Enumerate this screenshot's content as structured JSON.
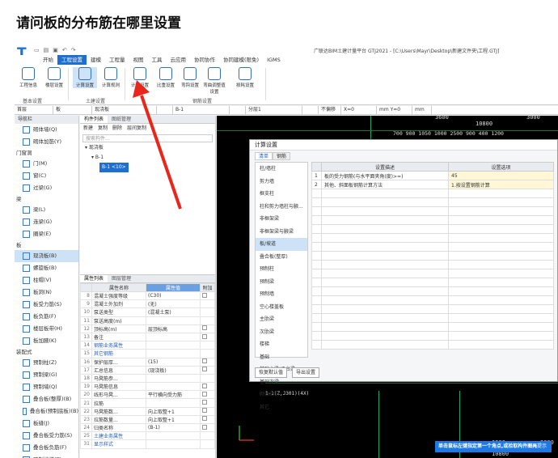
{
  "question": {
    "title": "请问板的分布筋在哪里设置"
  },
  "app": {
    "window_title": "广联达BIM土建计量平台 GTJ2021 - [C:\\Users\\Mayr\\Desktop\\新建文件夹\\工程.GTJ]",
    "menu": [
      "开始",
      "工程设置",
      "建模",
      "工程量",
      "视图",
      "工具",
      "云应用",
      "协同协作",
      "协同建模(限免)",
      "IGMS"
    ],
    "menu_active": 1,
    "ribbon": {
      "buttons": [
        {
          "label": "工程信息",
          "icon": "info-icon"
        },
        {
          "label": "楼层设置",
          "icon": "floors-icon"
        },
        {
          "label": "计算设置",
          "icon": "calc-settings-icon",
          "selected": true
        },
        {
          "label": "计算规则",
          "icon": "rules-icon"
        },
        {
          "label": "计算设置",
          "icon": "calc-settings-icon"
        },
        {
          "label": "比重设置",
          "icon": "weight-icon"
        },
        {
          "label": "弯钩设置",
          "icon": "hook-icon"
        },
        {
          "label": "弯曲调整值设置",
          "icon": "bend-icon"
        },
        {
          "label": "损耗设置",
          "icon": "loss-icon"
        }
      ],
      "groups": [
        "基本设置",
        "土建设置",
        "钢筋设置"
      ]
    },
    "propbar": [
      "首层",
      "板",
      "现浇板",
      "",
      "B-1",
      "",
      "分层1",
      "",
      "不偏移",
      "X=0",
      "mm Y=0",
      "mm"
    ],
    "nav": {
      "header": "导航栏",
      "items": [
        {
          "label": "砌体墙(Q)",
          "type": "item"
        },
        {
          "label": "砌体加筋(Y)",
          "type": "item"
        },
        {
          "label": "门窗洞",
          "type": "group"
        },
        {
          "label": "门(M)",
          "type": "item"
        },
        {
          "label": "窗(C)",
          "type": "item"
        },
        {
          "label": "过梁(G)",
          "type": "item"
        },
        {
          "label": "梁",
          "type": "group"
        },
        {
          "label": "梁(L)",
          "type": "item"
        },
        {
          "label": "连梁(G)",
          "type": "item"
        },
        {
          "label": "圈梁(E)",
          "type": "item"
        },
        {
          "label": "板",
          "type": "group"
        },
        {
          "label": "现浇板(B)",
          "type": "item",
          "selected": true
        },
        {
          "label": "螺旋板(B)",
          "type": "item"
        },
        {
          "label": "柱帽(V)",
          "type": "item"
        },
        {
          "label": "板洞(N)",
          "type": "item"
        },
        {
          "label": "板受力筋(S)",
          "type": "item"
        },
        {
          "label": "板负筋(F)",
          "type": "item"
        },
        {
          "label": "楼层板带(H)",
          "type": "item"
        },
        {
          "label": "板加腋(K)",
          "type": "item"
        },
        {
          "label": "装配式",
          "type": "group"
        },
        {
          "label": "预制柱(Z)",
          "type": "item"
        },
        {
          "label": "预制梁(G)",
          "type": "item"
        },
        {
          "label": "预制墙(Q)",
          "type": "item"
        },
        {
          "label": "叠合板(整厚)(B)",
          "type": "item"
        },
        {
          "label": "叠合板(预制底板)(B)",
          "type": "item"
        },
        {
          "label": "板缝(J)",
          "type": "item"
        },
        {
          "label": "叠合板受力筋(S)",
          "type": "item"
        },
        {
          "label": "叠合板负筋(F)",
          "type": "item"
        },
        {
          "label": "预制楼梯(T)",
          "type": "item"
        }
      ]
    },
    "component_list": {
      "tabs": [
        "构件列表",
        "图纸管理"
      ],
      "tools": [
        "新建",
        "复制",
        "删除",
        "层间复制"
      ],
      "search_placeholder": "搜索构件...",
      "tree": [
        "现浇板",
        "B-1",
        "B-1 <10>"
      ]
    },
    "properties": {
      "tabs": [
        "属性列表",
        "图层管理"
      ],
      "headers": [
        "属性名称",
        "属性值",
        "附加"
      ],
      "rows": [
        {
          "n": "8",
          "name": "混凝土强度等级",
          "value": "(C30)",
          "cb": true
        },
        {
          "n": "9",
          "name": "混凝土外加剂",
          "value": "(无)",
          "cb": false
        },
        {
          "n": "10",
          "name": "泵送类型",
          "value": "(混凝土泵)",
          "cb": false
        },
        {
          "n": "11",
          "name": "泵送高度(m)",
          "value": "",
          "cb": false
        },
        {
          "n": "12",
          "name": "顶标高(m)",
          "value": "层顶标高",
          "cb": true
        },
        {
          "n": "13",
          "name": "备注",
          "value": "",
          "cb": true
        },
        {
          "n": "14",
          "name": "钢筋业务属性",
          "value": "",
          "cb": false
        },
        {
          "n": "15",
          "name": "其它钢筋",
          "value": "",
          "cb": false
        },
        {
          "n": "16",
          "name": "保护层厚...",
          "value": "(15)",
          "cb": true
        },
        {
          "n": "17",
          "name": "汇总信息",
          "value": "(现浇板)",
          "cb": true
        },
        {
          "n": "18",
          "name": "马凳筋参...",
          "value": "",
          "cb": false
        },
        {
          "n": "19",
          "name": "马凳筋信息",
          "value": "",
          "cb": true
        },
        {
          "n": "20",
          "name": "线形马凳...",
          "value": "平行横向受力筋",
          "cb": true
        },
        {
          "n": "21",
          "name": "拉筋",
          "value": "",
          "cb": true
        },
        {
          "n": "22",
          "name": "马凳筋数...",
          "value": "向上取整+1",
          "cb": true
        },
        {
          "n": "23",
          "name": "拉筋数量...",
          "value": "向上取整+1",
          "cb": true
        },
        {
          "n": "24",
          "name": "归类名称",
          "value": "(B-1)",
          "cb": true
        },
        {
          "n": "25",
          "name": "土建业务属性",
          "value": "",
          "cb": false
        },
        {
          "n": "31",
          "name": "显示样式",
          "value": "",
          "cb": false
        }
      ]
    },
    "canvas": {
      "dims_top": [
        "10800",
        "3000",
        "3600"
      ],
      "dims_top2": "700 900 1050 1000 2500 900 400 1200",
      "dims_bottom": [
        "6900",
        "10800",
        "3000"
      ],
      "label_bottom": "1-1(Z,J301)(4X)"
    },
    "dialog": {
      "title": "计算设置",
      "tabs": [
        "清单",
        "钢筋"
      ],
      "list": [
        "柱/墙柱",
        "剪力墙",
        "框支柱",
        "柱和剪力墙柱与腋...",
        "非框架梁",
        "非框架梁与腋梁",
        "板/坡道",
        "叠合板(整厚)",
        "预制柱",
        "预制梁",
        "预制墙",
        "空心楼盖板",
        "主肋梁",
        "次肋梁",
        "楼梯",
        "基础",
        "基础主梁/承台梁",
        "基础次梁",
        "砌体结构",
        "其它"
      ],
      "list_selected": 6,
      "headers": [
        "",
        "设置描述",
        "设置选项"
      ],
      "rows": [
        {
          "n": "1",
          "desc": "板的受力钢筋(与水平面夹角(度)>=)",
          "val": "45"
        },
        {
          "n": "2",
          "desc": "其他、斜面板钢筋计算方法",
          "val": "1.按设置钢筋计算"
        }
      ],
      "buttons": [
        "恢复默认值",
        "导出设置"
      ]
    },
    "toast": {
      "text": "单击鼠标左键指定第一个角点,或拾取构件图元",
      "close": "不再提示"
    }
  }
}
